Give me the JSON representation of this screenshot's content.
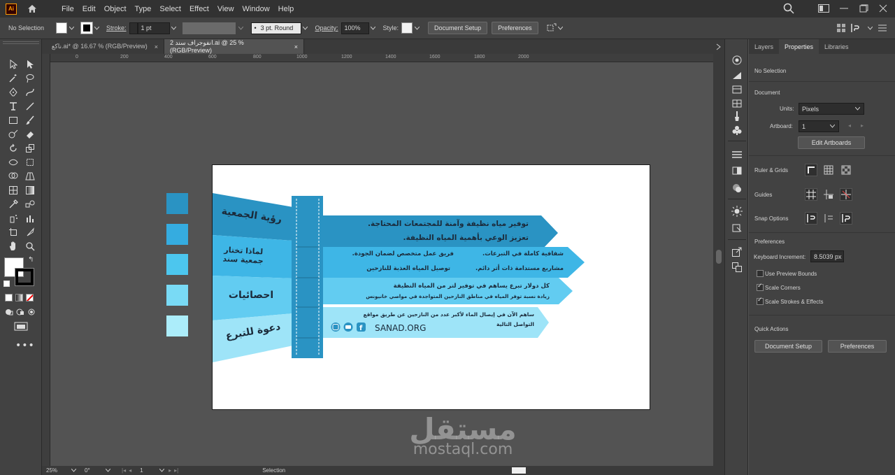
{
  "app": {
    "logo": "Ai"
  },
  "menu": [
    "File",
    "Edit",
    "Object",
    "Type",
    "Select",
    "Effect",
    "View",
    "Window",
    "Help"
  ],
  "control_bar": {
    "selection": "No Selection",
    "stroke_label": "Stroke:",
    "stroke_value": "1 pt",
    "brush": "3 pt. Round",
    "opacity_label": "Opacity:",
    "opacity_value": "100%",
    "style_label": "Style:",
    "document_setup": "Document Setup",
    "preferences": "Preferences"
  },
  "tabs": [
    {
      "label": "ناكع.ai* @ 16.67 % (RGB/Preview)",
      "close": "×"
    },
    {
      "label": "انفوجراف سند 2.ai @ 25 % (RGB/Preview)",
      "close": "×"
    }
  ],
  "ruler_top": [
    "0",
    "200",
    "400",
    "600",
    "800",
    "1000",
    "1200",
    "1400",
    "1600",
    "1800",
    "2000"
  ],
  "status_bar": {
    "zoom": "25%",
    "rotation": "0°",
    "artboard": "1",
    "tool": "Selection"
  },
  "properties": {
    "tabs": [
      "Layers",
      "Properties",
      "Libraries"
    ],
    "selection": "No Selection",
    "document_heading": "Document",
    "units_label": "Units:",
    "units_value": "Pixels",
    "artboard_label": "Artboard:",
    "artboard_value": "1",
    "edit_artboards": "Edit Artboards",
    "ruler_grids": "Ruler & Grids",
    "guides": "Guides",
    "snap_options": "Snap Options",
    "preferences_heading": "Preferences",
    "keyboard_increment_label": "Keyboard Increment:",
    "keyboard_increment_value": "8.5039 px",
    "checkboxes": [
      {
        "label": "Use Preview Bounds",
        "checked": false
      },
      {
        "label": "Scale Corners",
        "checked": true
      },
      {
        "label": "Scale Strokes & Effects",
        "checked": true
      }
    ],
    "quick_actions": "Quick Actions",
    "btn_document_setup": "Document Setup",
    "btn_preferences": "Preferences"
  },
  "artwork": {
    "swatches": [
      "#2a93c3",
      "#35ace0",
      "#4cc6ee",
      "#79daf5",
      "#acedfa"
    ],
    "banners": [
      "رؤية الجمعية",
      "لماذا تختار جمعية سند",
      "احصائيات",
      "دعوة للتبرع"
    ],
    "row1": [
      "توفير مياه نظيفة وآمنة للمجتمعات المحتاجة.",
      "تعزيز الوعي بأهمية المياه النظيفة."
    ],
    "row2": [
      "شفافية كاملة في التبرعات.",
      "فريق عمل متخصص لضمان الجودة.",
      "مشاريع مستدامة ذات أثر دائم.",
      "توصيل المياه العذبة للنازحين"
    ],
    "row3": [
      "كل دولار تبرع يساهم في توفير لتر من المياه النظيفة",
      "زيادة نسبة توفر المياه في مناطق النازحين المتواجدة في مواصي خانيونس"
    ],
    "row4": [
      "ساهم الآن في إيصال الماء لأكبر عدد من النازحين عن طريق مواقع التواصل التالية"
    ],
    "site": "SANAD.ORG"
  },
  "watermark": {
    "arabic": "مستقل",
    "latin": "mostaql.com"
  }
}
